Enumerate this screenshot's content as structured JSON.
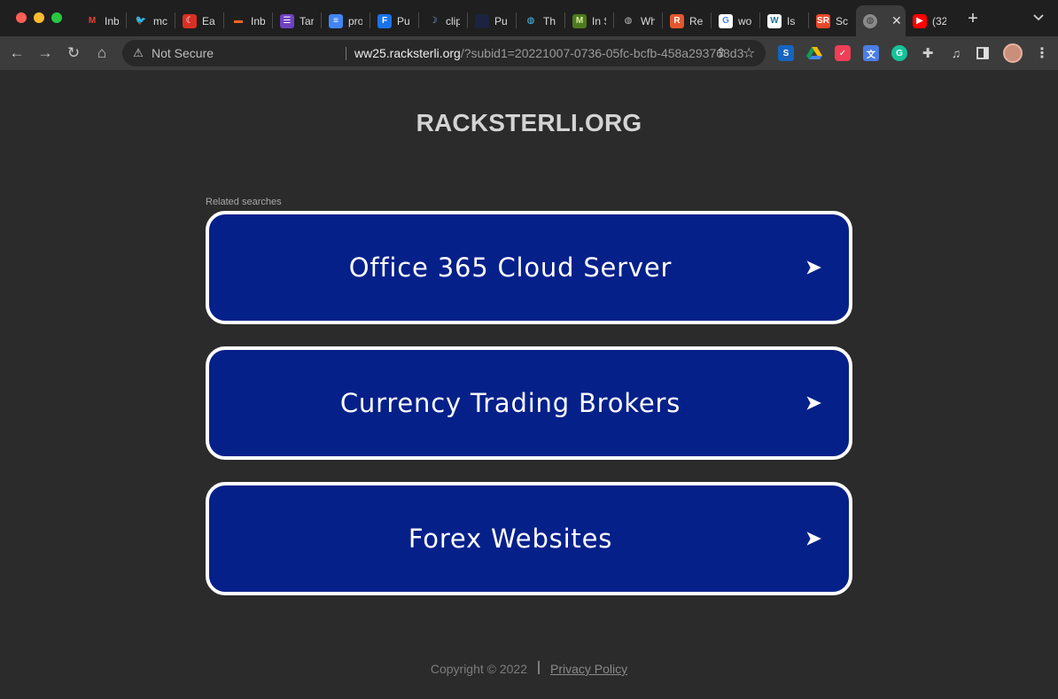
{
  "browser": {
    "tabs": [
      {
        "title": "Inb",
        "icon": "gmail-icon",
        "color": "#1f1f1f",
        "glyph": "M",
        "fg": "#ea4335"
      },
      {
        "title": "mc",
        "icon": "twitter-icon",
        "color": "#1f1f1f",
        "glyph": "🐦",
        "fg": "#1da1f2"
      },
      {
        "title": "Ea",
        "icon": "red-circle-icon",
        "color": "#d93025",
        "glyph": "☾",
        "fg": "#ffffff"
      },
      {
        "title": "Inb",
        "icon": "bookmark-icon",
        "color": "#1f1f1f",
        "glyph": "▬",
        "fg": "#f26522"
      },
      {
        "title": "Tar",
        "icon": "list-icon",
        "color": "#6f42c1",
        "glyph": "☰",
        "fg": "#ffffff"
      },
      {
        "title": "pro",
        "icon": "docs-icon",
        "color": "#4285f4",
        "glyph": "≡",
        "fg": "#ffffff"
      },
      {
        "title": "Pu",
        "icon": "f-icon",
        "color": "#1a73e8",
        "glyph": "F",
        "fg": "#ffffff"
      },
      {
        "title": "clip",
        "icon": "moon-icon",
        "color": "#1f1f1f",
        "glyph": "☽",
        "fg": "#8ab4f8"
      },
      {
        "title": "Pu",
        "icon": "dark-circle-icon",
        "color": "#1b2340",
        "glyph": "",
        "fg": "#ffffff"
      },
      {
        "title": "Th",
        "icon": "globe-icon",
        "color": "#1f1f1f",
        "glyph": "◍",
        "fg": "#4fc3f7"
      },
      {
        "title": "In S",
        "icon": "m-icon",
        "color": "#4e7a1e",
        "glyph": "M",
        "fg": "#d7f0a0"
      },
      {
        "title": "Wh",
        "icon": "world-icon",
        "color": "#1f1f1f",
        "glyph": "◍",
        "fg": "#bdbdbd"
      },
      {
        "title": "Re",
        "icon": "r-icon",
        "color": "#e4572e",
        "glyph": "R",
        "fg": "#ffffff"
      },
      {
        "title": "wo",
        "icon": "google-icon",
        "color": "#ffffff",
        "glyph": "G",
        "fg": "#4285f4"
      },
      {
        "title": "Is",
        "icon": "wordpress-icon",
        "color": "#ffffff",
        "glyph": "W",
        "fg": "#21759b"
      },
      {
        "title": "Sc",
        "icon": "sr-icon",
        "color": "#e8492b",
        "glyph": "SR",
        "fg": "#ffffff"
      }
    ],
    "active_tab_icon": "globe-icon",
    "active_tab_close": "✕",
    "youtube_tab": {
      "title": "(32",
      "icon": "youtube-icon"
    },
    "new_tab": "+",
    "security_label": "Not Secure",
    "url_host": "ww25.racksterli.org",
    "url_path": "/?subid1=20221007-0736-05fc-bcfb-458a293768d3"
  },
  "page": {
    "site_title": "RACKSTERLI.ORG",
    "related_label": "Related searches",
    "results": [
      {
        "label": "Office 365 Cloud Server"
      },
      {
        "label": "Currency Trading Brokers"
      },
      {
        "label": "Forex Websites"
      }
    ],
    "arrow": "➤",
    "copyright": "Copyright © 2022",
    "privacy_link": "Privacy Policy"
  },
  "colors": {
    "page_bg": "#2b2b2b",
    "card_bg": "#06208a",
    "card_border": "#ffffff"
  }
}
